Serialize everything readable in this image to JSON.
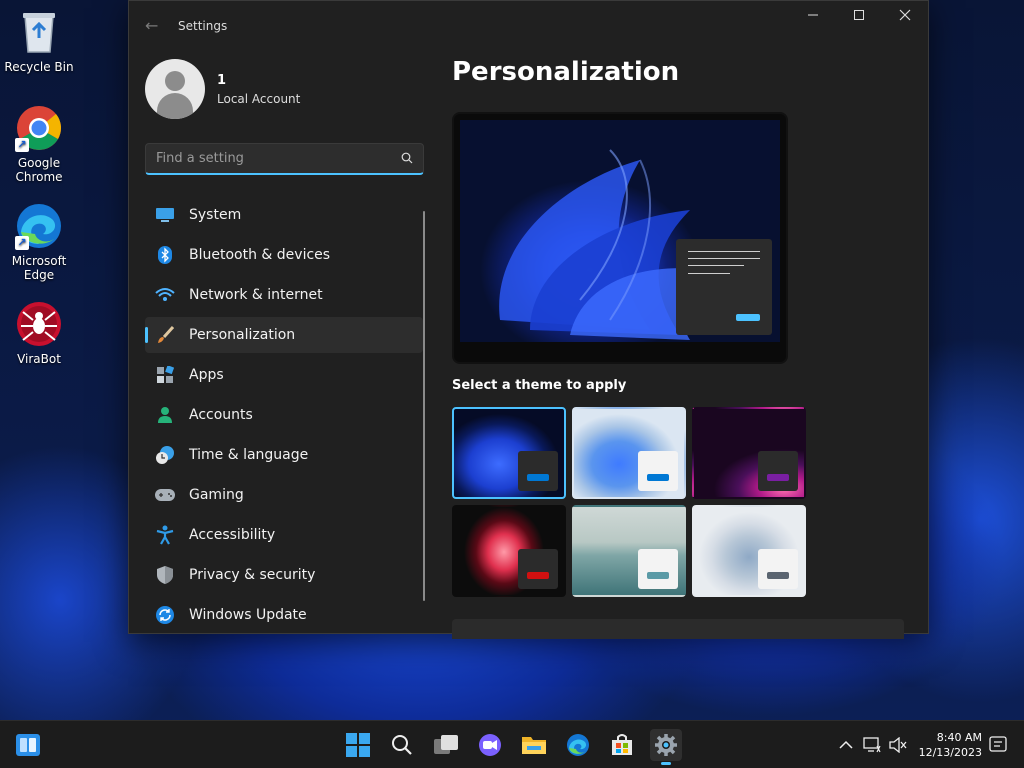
{
  "desktop": {
    "icons": [
      {
        "label": "Recycle Bin",
        "icon": "recycle-bin-icon"
      },
      {
        "label": "Google\nChrome",
        "icon": "chrome-icon"
      },
      {
        "label": "Microsoft\nEdge",
        "icon": "edge-icon"
      },
      {
        "label": "ViraBot",
        "icon": "virabot-icon"
      }
    ]
  },
  "window": {
    "title": "Settings",
    "controls": [
      "minimize",
      "maximize",
      "close"
    ],
    "profile": {
      "name": "1",
      "account_type": "Local Account"
    },
    "search": {
      "placeholder": "Find a setting"
    },
    "nav": [
      {
        "label": "System",
        "icon": "system-icon"
      },
      {
        "label": "Bluetooth & devices",
        "icon": "bluetooth-icon"
      },
      {
        "label": "Network & internet",
        "icon": "wifi-icon"
      },
      {
        "label": "Personalization",
        "icon": "brush-icon",
        "active": true
      },
      {
        "label": "Apps",
        "icon": "apps-icon"
      },
      {
        "label": "Accounts",
        "icon": "accounts-icon"
      },
      {
        "label": "Time & language",
        "icon": "time-language-icon"
      },
      {
        "label": "Gaming",
        "icon": "gaming-icon"
      },
      {
        "label": "Accessibility",
        "icon": "accessibility-icon"
      },
      {
        "label": "Privacy & security",
        "icon": "shield-icon"
      },
      {
        "label": "Windows Update",
        "icon": "update-icon"
      }
    ],
    "content": {
      "page_title": "Personalization",
      "themes_label": "Select a theme to apply",
      "themes": [
        {
          "name": "windows-dark-bloom",
          "selected": true,
          "accent": "#0078d4"
        },
        {
          "name": "windows-light-bloom",
          "selected": false,
          "accent": "#0078d4"
        },
        {
          "name": "glow",
          "selected": false,
          "accent": "#7a1fa2"
        },
        {
          "name": "captured-motion",
          "selected": false,
          "accent": "#d01010"
        },
        {
          "name": "sunrise",
          "selected": false,
          "accent": "#5a9aa6"
        },
        {
          "name": "flow",
          "selected": false,
          "accent": "#5a6470"
        }
      ]
    }
  },
  "taskbar": {
    "items": [
      "widgets-icon",
      "start-icon",
      "search-icon",
      "task-view-icon",
      "chat-icon",
      "file-explorer-icon",
      "edge-icon",
      "store-icon",
      "settings-icon"
    ],
    "clock": {
      "time": "8:40 AM",
      "date": "12/13/2023"
    }
  },
  "colors": {
    "accent": "#4cc2ff",
    "window_bg": "#202020",
    "taskbar_bg": "#1c1c1c"
  }
}
